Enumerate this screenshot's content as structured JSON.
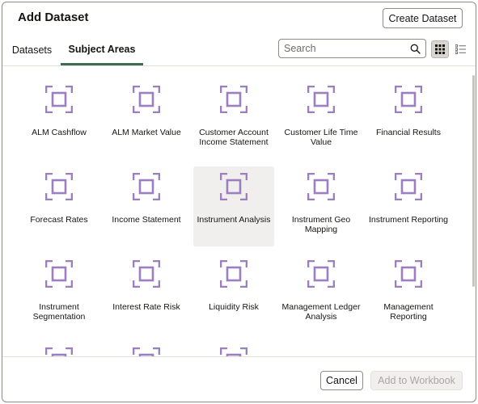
{
  "dialog": {
    "title": "Add Dataset",
    "create_button": "Create Dataset"
  },
  "tabs": [
    {
      "label": "Datasets",
      "active": false
    },
    {
      "label": "Subject Areas",
      "active": true
    }
  ],
  "search": {
    "placeholder": "Search",
    "value": "",
    "icon": "search-icon"
  },
  "view_toggle": {
    "grid_icon": "grid-view-icon",
    "list_icon": "list-view-icon",
    "selected": "grid"
  },
  "subject_areas": [
    {
      "label": "ALM Cashflow"
    },
    {
      "label": "ALM Market Value"
    },
    {
      "label": "Customer Account Income Statement"
    },
    {
      "label": "Customer Life Time Value"
    },
    {
      "label": "Financial Results"
    },
    {
      "label": "Forecast Rates"
    },
    {
      "label": "Income Statement"
    },
    {
      "label": "Instrument Analysis",
      "selected": true
    },
    {
      "label": "Instrument Geo Mapping"
    },
    {
      "label": "Instrument Reporting"
    },
    {
      "label": "Instrument Segmentation"
    },
    {
      "label": "Interest Rate Risk"
    },
    {
      "label": "Liquidity Risk"
    },
    {
      "label": "Management Ledger Analysis"
    },
    {
      "label": "Management Reporting"
    },
    {
      "label": ""
    },
    {
      "label": ""
    },
    {
      "label": ""
    }
  ],
  "footer": {
    "cancel_label": "Cancel",
    "add_label": "Add to Workbook"
  },
  "colors": {
    "icon": "#9b7fbf",
    "tab_underline": "#3e6b51",
    "selected_tile": "#f1efed"
  }
}
